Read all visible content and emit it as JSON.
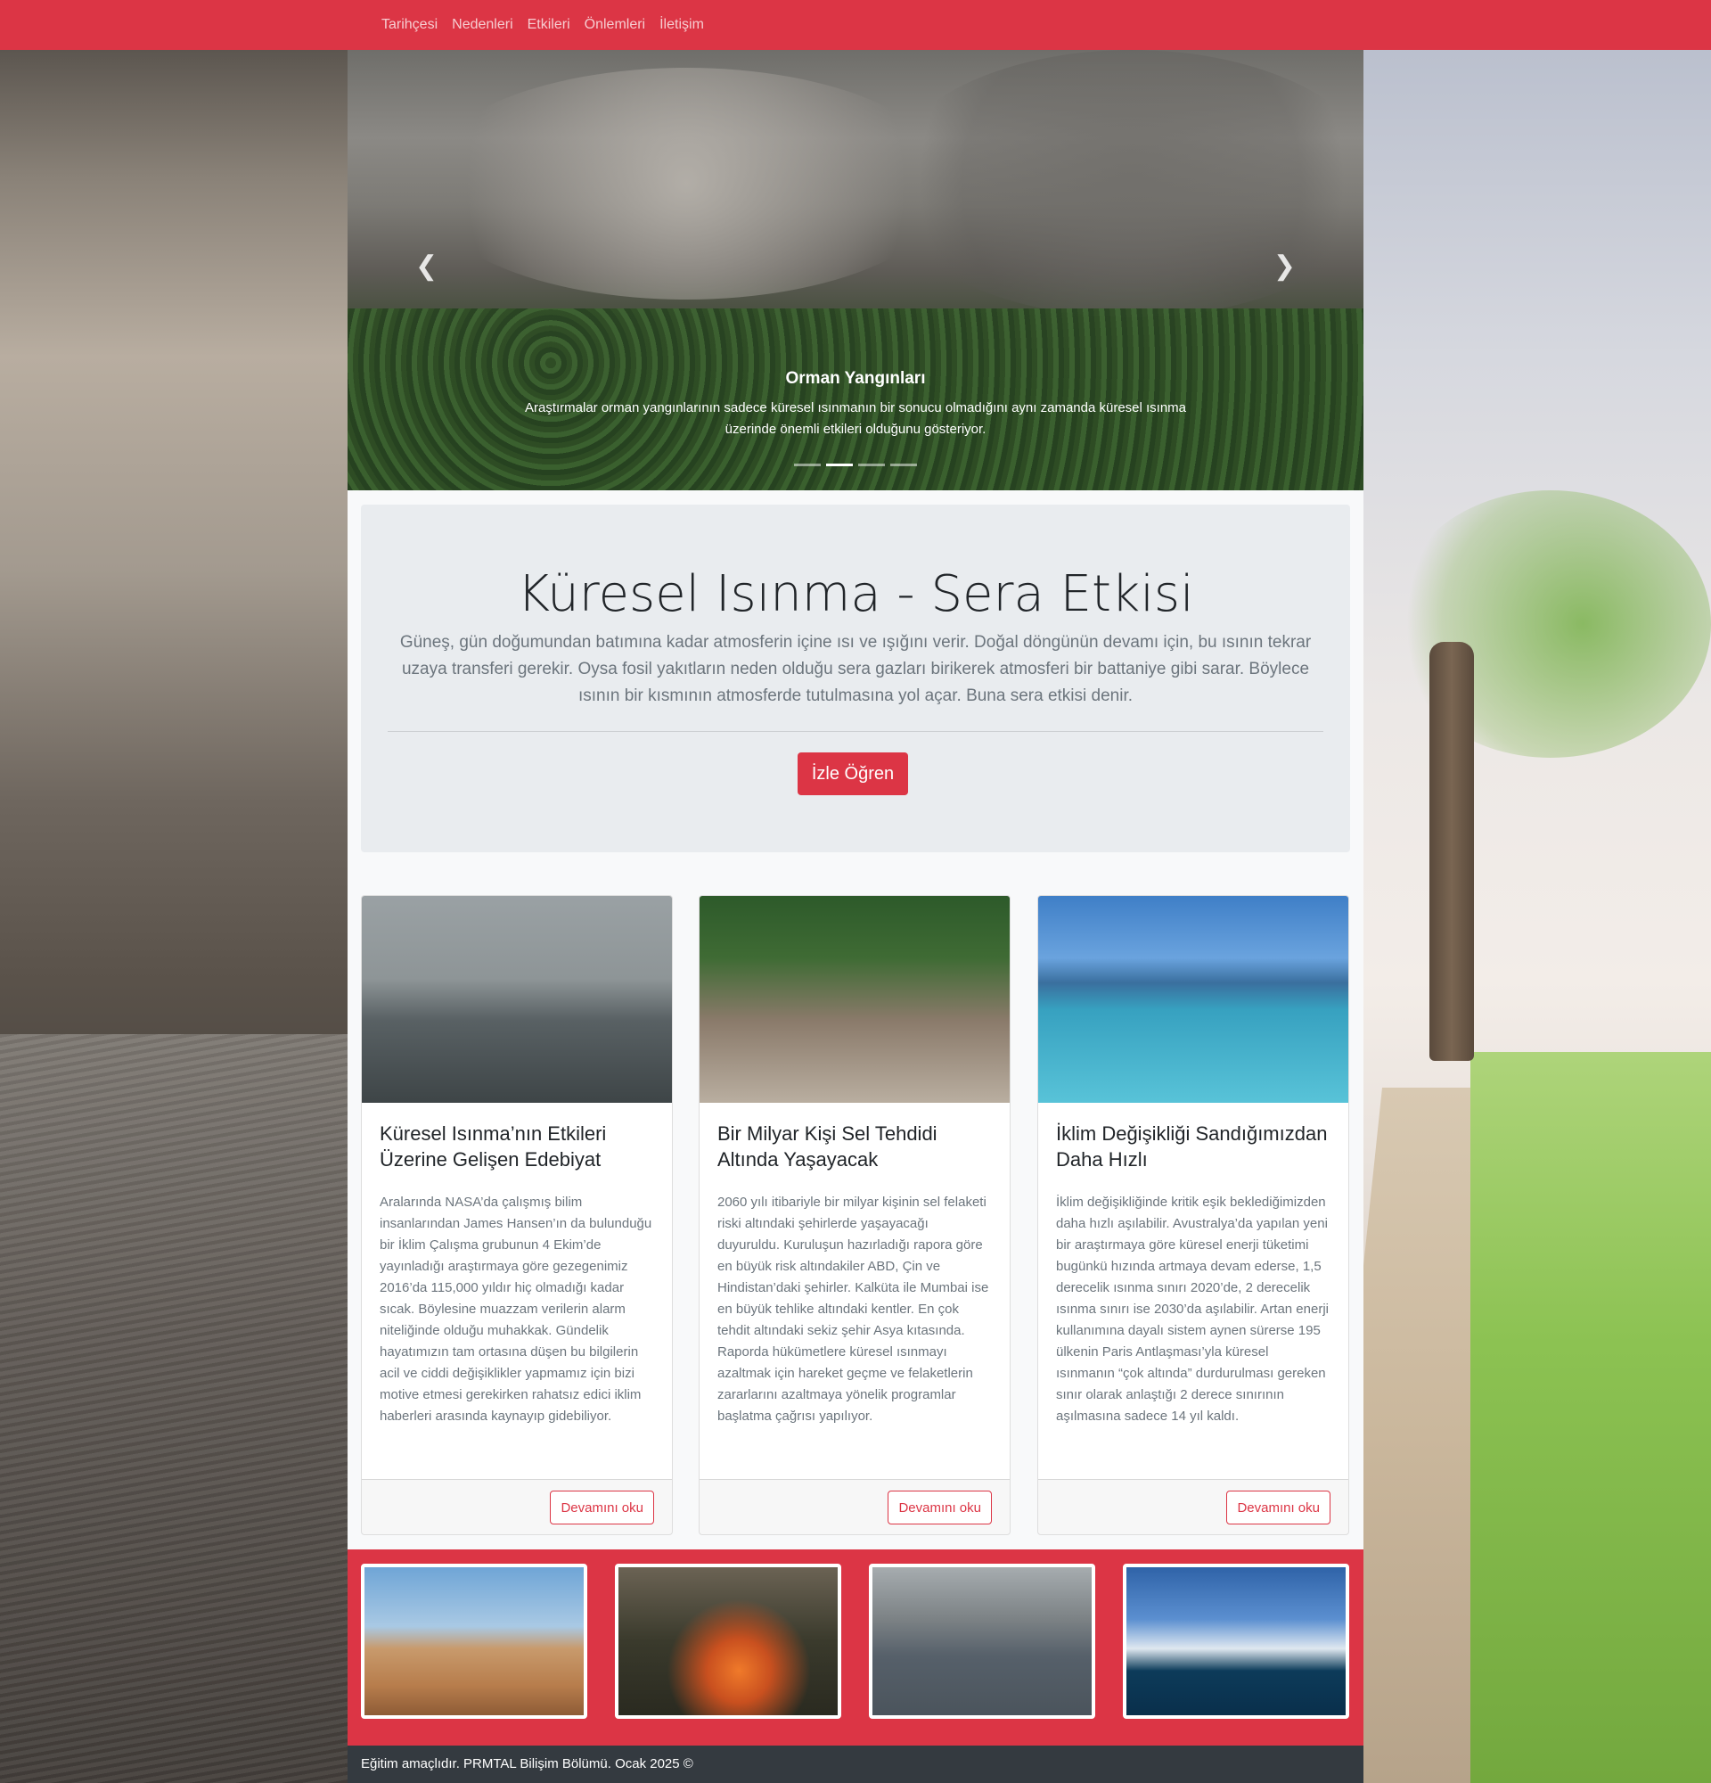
{
  "nav": {
    "items": [
      {
        "label": "Tarihçesi"
      },
      {
        "label": "Nedenleri"
      },
      {
        "label": "Etkileri"
      },
      {
        "label": "Önlemleri"
      },
      {
        "label": "İletişim"
      }
    ]
  },
  "carousel": {
    "caption_title": "Orman Yangınları",
    "caption_text": "Araştırmalar orman yangınlarının sadece küresel ısınmanın bir sonucu olmadığını aynı zamanda küresel ısınma üzerinde önemli etkileri olduğunu gösteriyor.",
    "prev_icon": "chevron-left-icon",
    "next_icon": "chevron-right-icon",
    "slide_count": 4,
    "active_slide": 2
  },
  "jumbotron": {
    "title": "Küresel Isınma - Sera Etkisi",
    "lead": "Güneş, gün doğumundan batımına kadar atmosferin içine ısı ve ışığını verir. Doğal döngünün devamı için, bu ısının tekrar uzaya transferi gerekir. Oysa fosil yakıtların neden olduğu sera gazları birikerek atmosferi bir battaniye gibi sarar. Böylece ısının bir kısmının atmosferde tutulmasına yol açar. Buna sera etkisi denir.",
    "button": "İzle Öğren"
  },
  "cards": [
    {
      "title": "Küresel Isınma’nın Etkileri Üzerine Gelişen Edebiyat",
      "text": "Aralarında NASA’da çalışmış bilim insanlarından James Hansen’ın da bulunduğu bir İklim Çalışma grubunun 4 Ekim’de yayınladığı araştırmaya göre gezegenimiz 2016’da 115,000 yıldır hiç olmadığı kadar sıcak. Böylesine muazzam verilerin alarm niteliğinde olduğu muhakkak. Gündelik hayatımızın tam ortasına düşen bu bilgilerin acil ve ciddi değişiklikler yapmamız için bizi motive etmesi gerekirken rahatsız edici iklim haberleri arasında kaynayıp gidebiliyor.",
      "button": "Devamını oku"
    },
    {
      "title": "Bir Milyar Kişi Sel Tehdidi Altında Yaşayacak",
      "text": "2060 yılı itibariyle bir milyar kişinin sel felaketi riski altındaki şehirlerde yaşayacağı duyuruldu. Kuruluşun hazırladığı rapora göre en büyük risk altındakiler ABD, Çin ve Hindistan’daki şehirler. Kalküta ile Mumbai ise en büyük tehlike altındaki kentler. En çok tehdit altındaki sekiz şehir Asya kıtasında. Raporda hükümetlere küresel ısınmayı azaltmak için hareket geçme ve felaketlerin zararlarını azaltmaya yönelik programlar başlatma çağrısı yapılıyor.",
      "button": "Devamını oku"
    },
    {
      "title": "İklim Değişikliği Sandığımızdan Daha Hızlı",
      "text": "İklim değişikliğinde kritik eşik beklediğimizden daha hızlı aşılabilir. Avustralya’da yapılan yeni bir araştırmaya göre küresel enerji tüketimi bugünkü hızında artmaya devam ederse, 1,5 derecelik ısınma sınırı 2020’de, 2 derecelik ısınma sınırı ise 2030’da aşılabilir. Artan enerji kullanımına dayalı sistem aynen sürerse 195 ülkenin Paris Antlaşması’yla küresel ısınmanın “çok altında” durdurulması gereken sınır olarak anlaştığı 2 derece sınırının aşılmasına sadece 14 yıl kaldı.",
      "button": "Devamını oku"
    }
  ],
  "footer": {
    "text": "Eğitim amaçlıdır. PRMTAL Bilişim Bölümü. Ocak 2025 ©"
  },
  "colors": {
    "accent": "#dc3545",
    "footer_bg": "#343a40",
    "jumbotron_bg": "#e9ecef"
  }
}
